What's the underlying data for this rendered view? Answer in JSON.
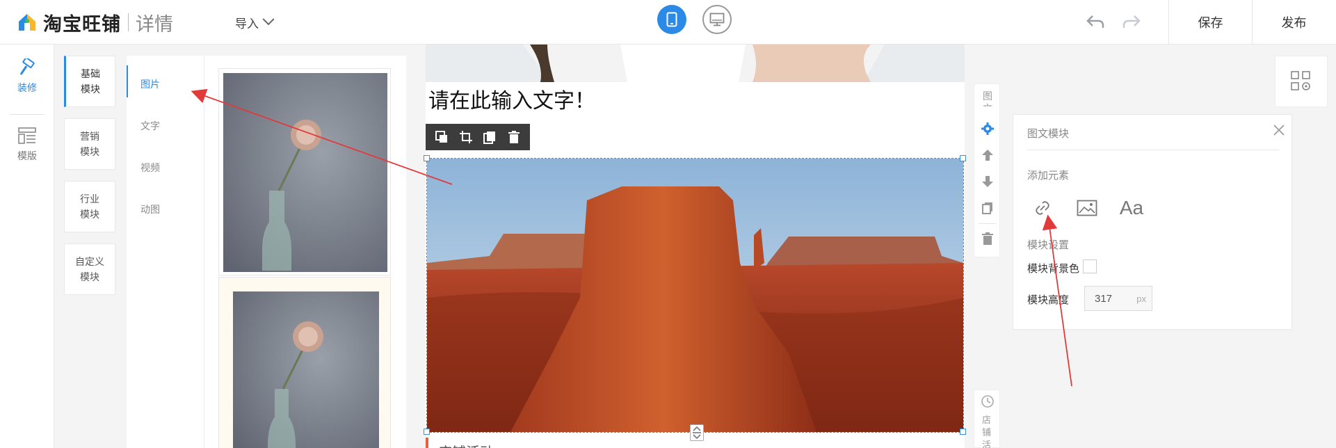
{
  "header": {
    "brand": "淘宝旺铺",
    "section": "详情",
    "import_label": "导入",
    "save_label": "保存",
    "publish_label": "发布"
  },
  "left_rail": {
    "items": [
      {
        "label": "装修",
        "icon": "hammer-icon"
      },
      {
        "label": "模版",
        "icon": "layout-icon"
      }
    ]
  },
  "categories": [
    {
      "label": "基础\n模块",
      "active": true
    },
    {
      "label": "营销\n模块"
    },
    {
      "label": "行业\n模块"
    },
    {
      "label": "自定义\n模块"
    }
  ],
  "subtabs": [
    {
      "label": "图片",
      "active": true
    },
    {
      "label": "文字"
    },
    {
      "label": "视频"
    },
    {
      "label": "动图"
    }
  ],
  "canvas": {
    "headline": "请在此输入文字！",
    "section_title": "店铺活动"
  },
  "side_rail": {
    "top_label": "图文",
    "bottom_label": "店铺活"
  },
  "panel": {
    "title": "图文模块",
    "add_element_label": "添加元素",
    "add_icons": [
      "link-icon",
      "image-icon",
      "text-icon"
    ],
    "text_icon_label": "Aa",
    "module_settings_label": "模块设置",
    "bg_color_label": "模块背景色",
    "height_label": "模块高度",
    "height_value": "317",
    "height_unit": "px"
  },
  "colors": {
    "accent": "#2a8ae6",
    "section_bar": "#e8613c",
    "annotation": "#e23a3a"
  }
}
